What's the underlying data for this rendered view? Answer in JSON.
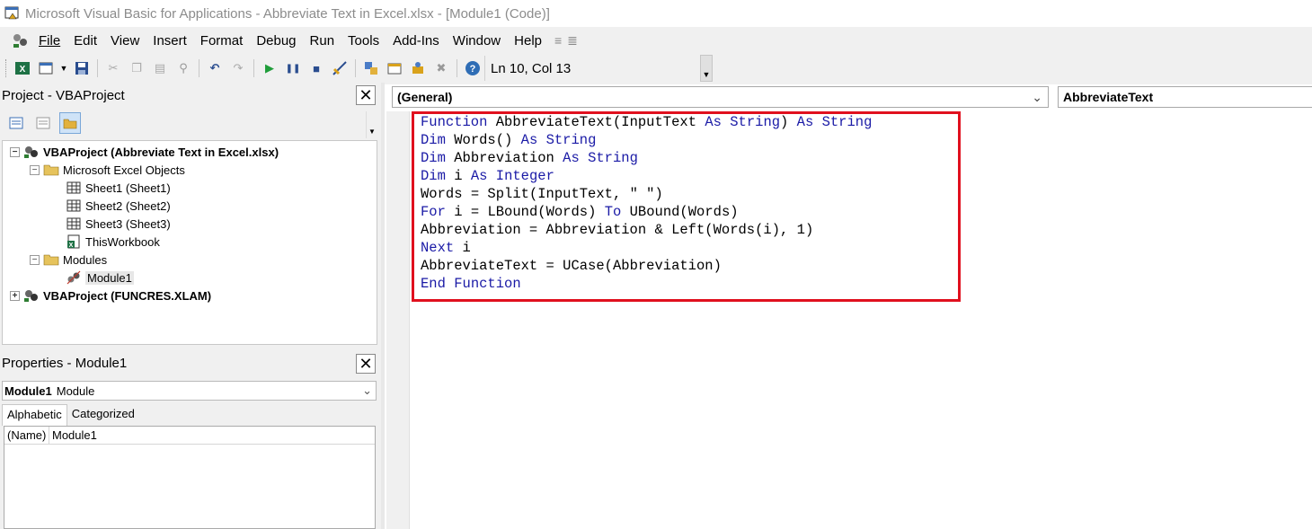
{
  "window": {
    "title": "Microsoft Visual Basic for Applications - Abbreviate Text in Excel.xlsx - [Module1 (Code)]"
  },
  "menu": {
    "items": [
      "File",
      "Edit",
      "View",
      "Insert",
      "Format",
      "Debug",
      "Run",
      "Tools",
      "Add-Ins",
      "Window",
      "Help"
    ]
  },
  "toolbar": {
    "cursor_position": "Ln 10, Col 13"
  },
  "project_pane": {
    "title": "Project - VBAProject",
    "tree": [
      {
        "label": "VBAProject (Abbreviate Text in Excel.xlsx)",
        "level": 0,
        "expanded": true,
        "icon": "vba-project-icon"
      },
      {
        "label": "Microsoft Excel Objects",
        "level": 1,
        "expanded": true,
        "icon": "folder-icon"
      },
      {
        "label": "Sheet1 (Sheet1)",
        "level": 2,
        "icon": "sheet-icon"
      },
      {
        "label": "Sheet2 (Sheet2)",
        "level": 2,
        "icon": "sheet-icon"
      },
      {
        "label": "Sheet3 (Sheet3)",
        "level": 2,
        "icon": "sheet-icon"
      },
      {
        "label": "ThisWorkbook",
        "level": 2,
        "icon": "workbook-icon"
      },
      {
        "label": "Modules",
        "level": 1,
        "expanded": true,
        "icon": "folder-icon"
      },
      {
        "label": "Module1",
        "level": 2,
        "icon": "module-icon",
        "selected": true
      },
      {
        "label": "VBAProject (FUNCRES.XLAM)",
        "level": 0,
        "expanded": false,
        "icon": "vba-project-icon"
      }
    ]
  },
  "properties_pane": {
    "title": "Properties - Module1",
    "object_name": "Module1",
    "object_type": "Module",
    "tabs": [
      "Alphabetic",
      "Categorized"
    ],
    "active_tab": "Alphabetic",
    "rows": [
      {
        "key": "(Name)",
        "value": "Module1"
      }
    ]
  },
  "code_window": {
    "object_combo": "(General)",
    "procedure_combo": "AbbreviateText",
    "lines": [
      "Function AbbreviateText(InputText As String) As String",
      "Dim Words() As String",
      "Dim Abbreviation As String",
      "Dim i As Integer",
      "Words = Split(InputText, \" \")",
      "For i = LBound(Words) To UBound(Words)",
      "Abbreviation = Abbreviation & Left(Words(i), 1)",
      "Next i",
      "AbbreviateText = UCase(Abbreviation)",
      "End Function"
    ],
    "keywords": [
      "Function",
      "As",
      "String",
      "Dim",
      "Integer",
      "For",
      "To",
      "Next",
      "End"
    ],
    "keyword_color": "#1a1aa6",
    "highlight_color": "#e0101e"
  }
}
